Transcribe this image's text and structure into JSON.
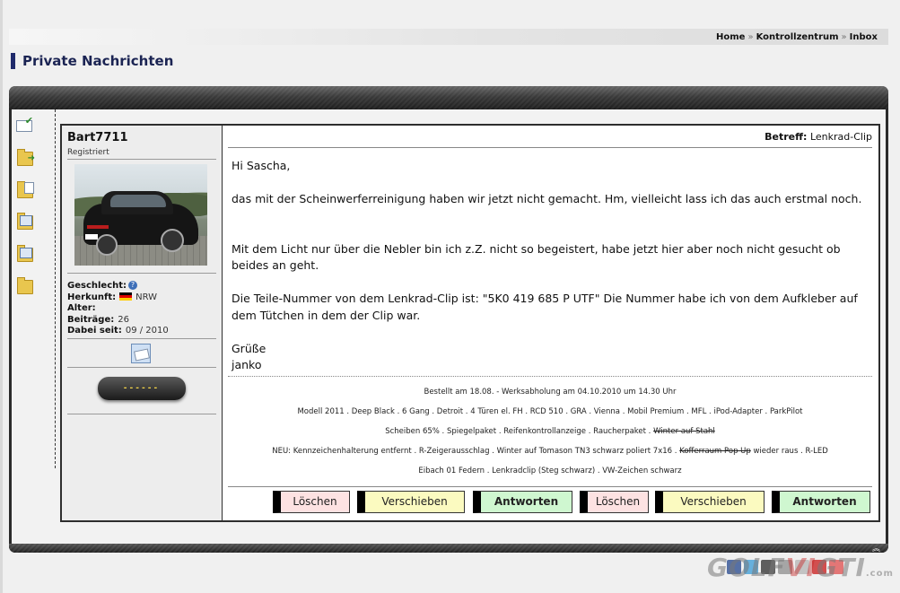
{
  "breadcrumb": {
    "items": [
      "Home",
      "Kontrollzentrum",
      "Inbox"
    ],
    "separator": "»"
  },
  "page_title": "Private Nachrichten",
  "sidebar_icons": [
    "inbox-icon",
    "forward-folder-icon",
    "folder-icon",
    "folder-list-icon",
    "folder-messages-icon",
    "folder-icon"
  ],
  "user": {
    "name": "Bart7711",
    "rank": "Registriert",
    "labels": {
      "gender": "Geschlecht:",
      "origin": "Herkunft:",
      "age": "Alter:",
      "posts": "Beiträge:",
      "since": "Dabei seit:"
    },
    "origin": "NRW",
    "posts": "26",
    "since": "09 / 2010",
    "row_button": "------"
  },
  "message": {
    "subject_label": "Betreff:",
    "subject": "Lenkrad-Clip",
    "lines": [
      "Hi Sascha,",
      "",
      "das mit der Scheinwerferreinigung haben wir jetzt nicht gemacht. Hm, vielleicht lass ich das auch erstmal noch.",
      "",
      "",
      "Mit dem Licht nur über die Nebler bin ich z.Z. nicht so begeistert, habe jetzt hier aber noch nicht gesucht ob beides an geht.",
      "",
      "Die Teile-Nummer von dem Lenkrad-Clip ist: \"5K0 419 685 P UTF\" Die Nummer habe ich von dem Aufkleber auf dem Tütchen in dem der Clip war.",
      "",
      "Grüße",
      "janko"
    ]
  },
  "signature": {
    "line1": "Bestellt am 18.08. - Werksabholung am 04.10.2010 um 14.30 Uhr",
    "line2": "Modell 2011 . Deep Black . 6 Gang . Detroit . 4 Türen el. FH . RCD 510 . GRA . Vienna . Mobil Premium . MFL . iPod-Adapter . ParkPilot",
    "line3a": "Scheiben 65% . Spiegelpaket . Reifenkontrollanzeige . Raucherpaket .",
    "line3b": "Winter auf Stahl",
    "line4a": "NEU: Kennzeichenhalterung entfernt . R-Zeigerausschlag . Winter auf Tomason TN3 schwarz poliert 7x16 .",
    "line4b": "Kofferraum Pop Up",
    "line4c": "wieder raus . R-LED",
    "line5": "Eibach 01 Federn . Lenkradclip (Steg schwarz) . VW-Zeichen schwarz"
  },
  "buttons": {
    "delete1": "Löschen",
    "move1": "Verschieben",
    "reply1": "Antworten",
    "delete2": "Löschen",
    "move2": "Verschieben",
    "reply2": "Antworten"
  },
  "watermark": {
    "part1": "GOLF",
    "part2": "VI",
    "part3": "GTI",
    "suffix": ".com"
  },
  "colors": {
    "title_bar": "#1f2a6b",
    "delete_bg": "#fde2e2",
    "move_bg": "#fbfac0",
    "reply_bg": "#cff7d0",
    "frame": "#2b2b2b"
  }
}
